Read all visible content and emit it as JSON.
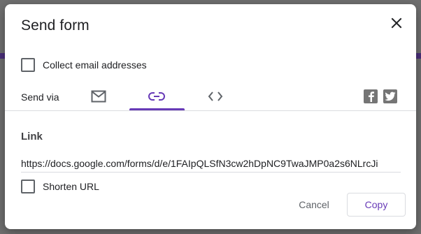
{
  "dialog": {
    "title": "Send form",
    "collect_email_label": "Collect email addresses",
    "send_via_label": "Send via",
    "tabs": [
      {
        "name": "email",
        "icon": "email-icon",
        "active": false
      },
      {
        "name": "link",
        "icon": "link-icon",
        "active": true
      },
      {
        "name": "embed",
        "icon": "embed-code-icon",
        "active": false
      }
    ],
    "social": [
      {
        "name": "facebook",
        "icon": "facebook-icon"
      },
      {
        "name": "twitter",
        "icon": "twitter-icon"
      }
    ],
    "link_section_label": "Link",
    "link_value": "https://docs.google.com/forms/d/e/1FAIpQLSfN3cw2hDpNC9TwaJMP0a2s6NLrcJi",
    "shorten_url_label": "Shorten URL",
    "cancel_label": "Cancel",
    "copy_label": "Copy"
  },
  "colors": {
    "accent": "#673ab7",
    "icon_gray": "#5f6368",
    "social_gray": "#757575",
    "overlay": "#6f6f6f"
  }
}
